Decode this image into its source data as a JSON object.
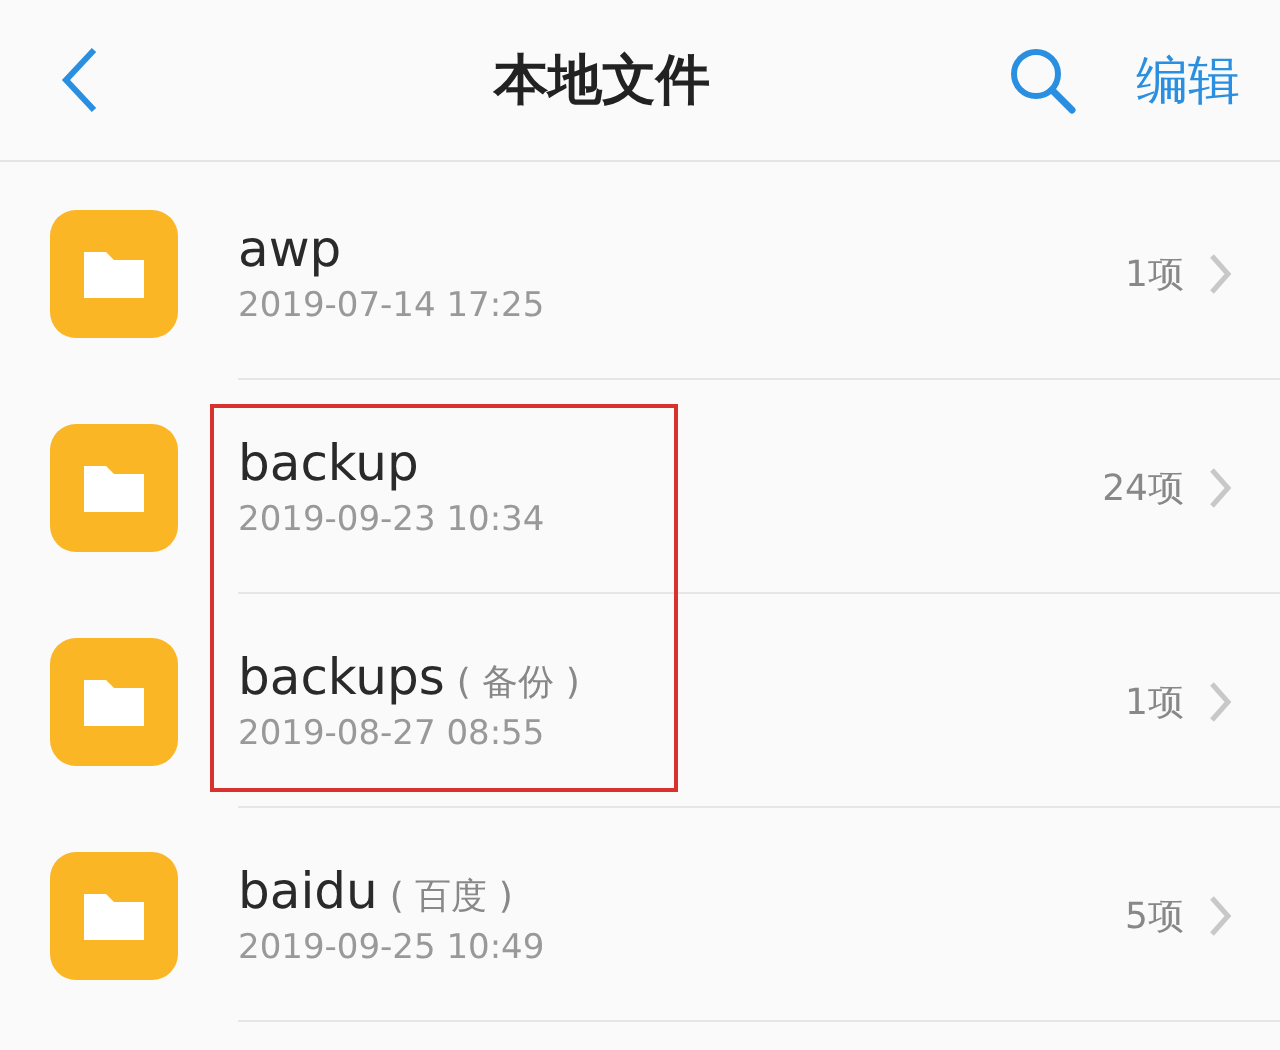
{
  "header": {
    "title": "本地文件",
    "action": "编辑"
  },
  "files": [
    {
      "name": "awp",
      "date": "2019-07-14 17:25",
      "count": "1项",
      "highlighted": false
    },
    {
      "name": "backup",
      "date": "2019-09-23 10:34",
      "count": "24项",
      "highlighted": true
    },
    {
      "name": "backups",
      "note": "( 备份 )",
      "date": "2019-08-27 08:55",
      "count": "1项",
      "highlighted": true
    },
    {
      "name": "baidu",
      "note": "( 百度 )",
      "date": "2019-09-25 10:49",
      "count": "5项",
      "highlighted": false
    }
  ]
}
